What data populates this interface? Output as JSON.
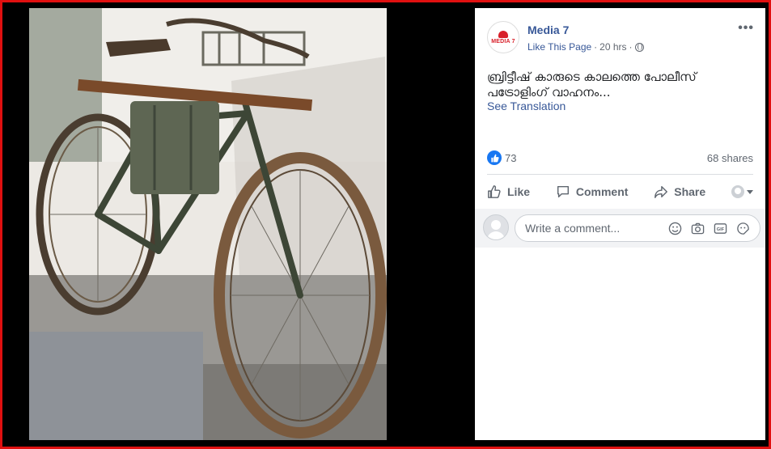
{
  "post": {
    "page_name": "Media 7",
    "like_page": "Like This Page",
    "time": "20 hrs",
    "text": "ബ്രിട്ടീഷ് കാരുടെ കാലത്തെ പോലീസ് പട്രോളിംഗ് വാഹനം...",
    "see_translation": "See Translation",
    "logo_text": "MEDIA 7"
  },
  "stats": {
    "reactions_count": "73",
    "shares": "68 shares"
  },
  "actions": {
    "like": "Like",
    "comment": "Comment",
    "share": "Share"
  },
  "comment_box": {
    "placeholder": "Write a comment..."
  },
  "icons": [
    "more-options-icon",
    "globe-icon",
    "like-reaction-icon",
    "thumbs-up-icon",
    "comment-bubble-icon",
    "share-arrow-icon",
    "viewer-avatar-icon",
    "emoji-icon",
    "camera-icon",
    "gif-icon",
    "sticker-icon"
  ],
  "colors": {
    "frame": "#e01010",
    "link_blue": "#385898",
    "like_blue": "#1877f2"
  }
}
